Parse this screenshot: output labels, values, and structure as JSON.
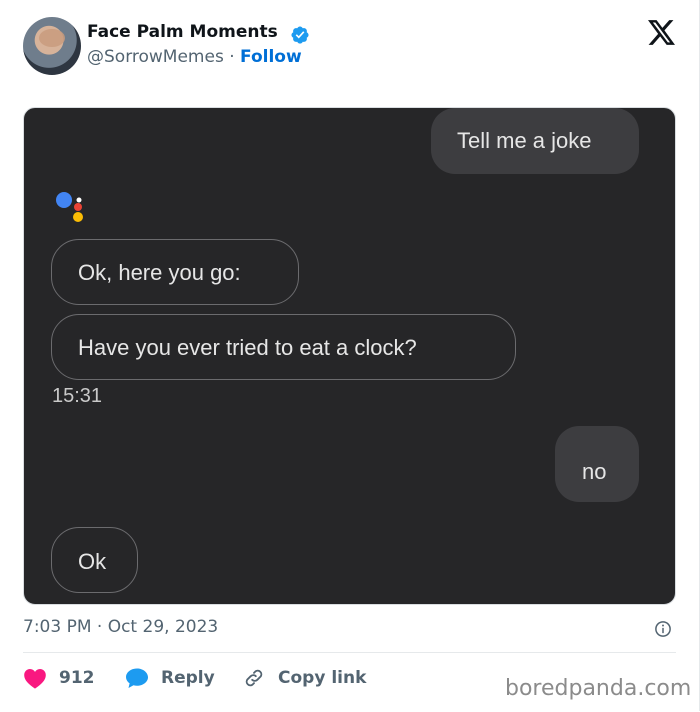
{
  "author": {
    "name": "Face Palm Moments",
    "handle": "@SorrowMemes",
    "separator": "·",
    "follow_label": "Follow"
  },
  "chat": {
    "messages": [
      {
        "role": "user",
        "text": "Tell me a joke"
      },
      {
        "role": "assistant",
        "text": "Ok, here you go:"
      },
      {
        "role": "assistant",
        "text": "Have you ever tried to eat a clock?"
      },
      {
        "role": "user",
        "text": "no"
      },
      {
        "role": "assistant",
        "text": "Ok"
      }
    ],
    "time": "15:31"
  },
  "tweet": {
    "timestamp": "7:03 PM · Oct 29, 2023"
  },
  "actions": {
    "likes": "912",
    "reply_label": "Reply",
    "copy_label": "Copy link"
  },
  "watermark": "boredpanda.com",
  "icons": {
    "verified": "verified-badge-icon",
    "platform": "x-logo-icon",
    "info": "info-icon",
    "like": "heart-icon",
    "reply": "speech-bubble-icon",
    "copy": "link-icon",
    "assistant": "google-assistant-dots-icon"
  },
  "colors": {
    "accent": "#006fd6",
    "verified": "#1d9bf0",
    "heart": "#f91880",
    "chat_bg": "#262628"
  }
}
